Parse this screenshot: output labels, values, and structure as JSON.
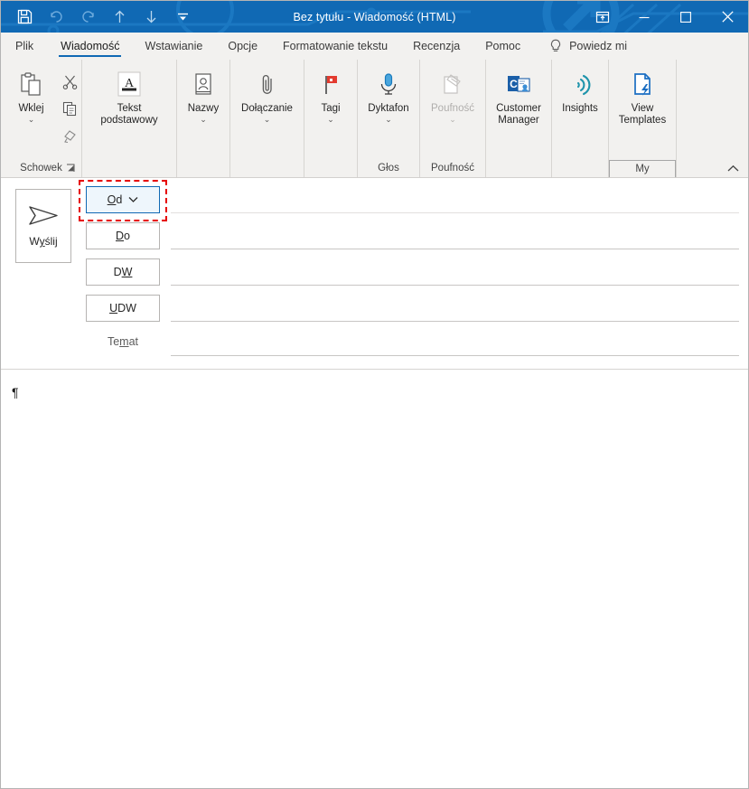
{
  "window": {
    "title": "Bez tytułu  -  Wiadomość (HTML)",
    "accent_color": "#1069b4",
    "ribbon_bg": "#f2f1ef",
    "highlight_color": "#e60000"
  },
  "quick_access": {
    "items": [
      {
        "name": "save-icon",
        "label": "Zapisz",
        "enabled": true
      },
      {
        "name": "undo-icon",
        "label": "Cofnij",
        "enabled": false
      },
      {
        "name": "redo-icon",
        "label": "Wykonaj ponownie",
        "enabled": false
      },
      {
        "name": "previous-item-icon",
        "label": "Poprzedni element",
        "enabled": true
      },
      {
        "name": "next-item-icon",
        "label": "Następny element",
        "enabled": true
      },
      {
        "name": "customize-qat-icon",
        "label": "Dostosuj pasek narzędzi Szybki dostęp",
        "enabled": true
      }
    ]
  },
  "window_controls": {
    "ribbon_display": "Opcje wyświetlania Wstążki",
    "minimize": "Minimalizuj",
    "maximize": "Maksymalizuj",
    "close": "Zamknij"
  },
  "tabs": [
    {
      "label": "Plik",
      "active": false
    },
    {
      "label": "Wiadomość",
      "active": true
    },
    {
      "label": "Wstawianie",
      "active": false
    },
    {
      "label": "Opcje",
      "active": false
    },
    {
      "label": "Formatowanie tekstu",
      "active": false
    },
    {
      "label": "Recenzja",
      "active": false
    },
    {
      "label": "Pomoc",
      "active": false
    }
  ],
  "tell_me": {
    "icon": "lightbulb-icon",
    "label": "Powiedz mi"
  },
  "ribbon": {
    "groups": [
      {
        "label": "Schowek",
        "has_launcher": true,
        "launcher_label": "Schowek",
        "buttons": [
          {
            "name": "paste-button",
            "label": "Wklej",
            "caret": true,
            "enabled": true,
            "icon": "clipboard-icon"
          }
        ],
        "small_buttons": [
          {
            "name": "cut-button",
            "label": "Wytnij",
            "icon": "scissors-icon"
          },
          {
            "name": "copy-button",
            "label": "Kopiuj",
            "icon": "copy-icon"
          },
          {
            "name": "format-painter-button",
            "label": "Malarz formatów",
            "icon": "paintbrush-icon"
          }
        ]
      },
      {
        "label": "",
        "has_launcher": false,
        "buttons": [
          {
            "name": "basic-text-button",
            "label": "Tekst\npodstawowy",
            "caret_inline": true,
            "enabled": true,
            "icon": "underlined-a-icon"
          }
        ]
      },
      {
        "label": "",
        "has_launcher": false,
        "buttons": [
          {
            "name": "names-button",
            "label": "Nazwy",
            "caret": true,
            "enabled": true,
            "icon": "address-book-icon"
          }
        ]
      },
      {
        "label": "",
        "has_launcher": false,
        "buttons": [
          {
            "name": "attach-button",
            "label": "Dołączanie",
            "caret": true,
            "enabled": true,
            "icon": "paperclip-icon"
          }
        ]
      },
      {
        "label": "",
        "has_launcher": false,
        "buttons": [
          {
            "name": "tags-button",
            "label": "Tagi",
            "caret": true,
            "enabled": true,
            "icon": "red-flag-icon"
          }
        ]
      },
      {
        "label": "Głos",
        "has_launcher": false,
        "buttons": [
          {
            "name": "dictate-button",
            "label": "Dyktafon",
            "caret": true,
            "enabled": true,
            "icon": "microphone-icon"
          }
        ]
      },
      {
        "label": "Poufność",
        "has_launcher": false,
        "buttons": [
          {
            "name": "sensitivity-button",
            "label": "Poufność",
            "caret": true,
            "enabled": false,
            "icon": "sensitivity-stamp-icon"
          }
        ]
      },
      {
        "label": "",
        "has_launcher": false,
        "buttons": [
          {
            "name": "customer-manager-button",
            "label": "Customer\nManager",
            "caret": false,
            "enabled": true,
            "icon": "outlook-customer-manager-icon"
          }
        ]
      },
      {
        "label": "",
        "has_launcher": false,
        "buttons": [
          {
            "name": "insights-button",
            "label": "Insights",
            "caret": false,
            "enabled": true,
            "icon": "insights-icon"
          }
        ]
      },
      {
        "label": "My Templates",
        "boxed_label": true,
        "has_launcher": false,
        "buttons": [
          {
            "name": "view-templates-button",
            "label": "View\nTemplates",
            "caret": false,
            "enabled": true,
            "icon": "template-document-icon"
          }
        ]
      }
    ],
    "collapse_label": "Zwiń Wstążkę"
  },
  "compose": {
    "send": {
      "label": "Wyślij",
      "access_key": "y",
      "icon": "send-arrow-icon"
    },
    "fields": [
      {
        "name": "from-field",
        "button": "Od",
        "access_key": "O",
        "value": "",
        "placeholder": "",
        "has_caret": true,
        "highlighted": true
      },
      {
        "name": "to-field",
        "button": "Do",
        "access_key": "D",
        "value": "",
        "placeholder": "",
        "has_caret": false,
        "highlighted": false
      },
      {
        "name": "cc-field",
        "button": "DW",
        "access_key": "W",
        "value": "",
        "placeholder": "",
        "has_caret": false,
        "highlighted": false
      },
      {
        "name": "bcc-field",
        "button": "UDW",
        "access_key": "U",
        "value": "",
        "placeholder": "",
        "has_caret": false,
        "highlighted": false
      }
    ],
    "subject": {
      "label": "Temat",
      "access_key": "m",
      "value": "",
      "placeholder": ""
    },
    "body": {
      "value": "",
      "paragraph_mark": "¶"
    }
  }
}
